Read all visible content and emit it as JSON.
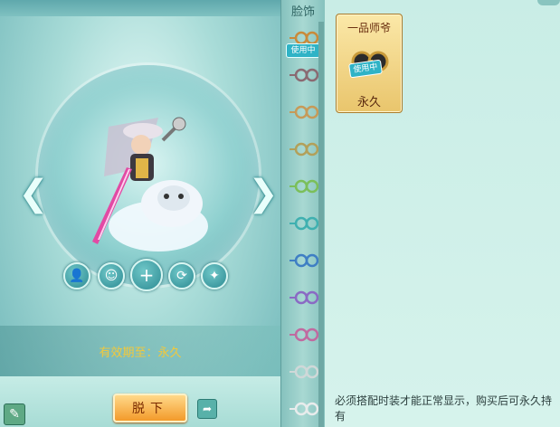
{
  "category": {
    "title": "脸饰",
    "in_use_tag": "使用中"
  },
  "swatches": [
    {
      "color": "#c98a3a"
    },
    {
      "color": "#8a6a72"
    },
    {
      "color": "#c69a58"
    },
    {
      "color": "#b2a05a"
    },
    {
      "color": "#7bbf5a"
    },
    {
      "color": "#3fb0b0"
    },
    {
      "color": "#3f7fc4"
    },
    {
      "color": "#8a6ac4"
    },
    {
      "color": "#c06aa0"
    },
    {
      "color": "#cfd8d8"
    },
    {
      "color": "#e8ecec"
    }
  ],
  "item": {
    "name": "一品师爷",
    "tag": "使用中",
    "duration": "永久"
  },
  "preview": {
    "validity": "有效期至：永久"
  },
  "buttons": {
    "remove": "脱下"
  },
  "note": "必须搭配时装才能正常显示，购买后可永久持有",
  "icons": [
    "arrow-left-icon",
    "arrow-right-icon",
    "person-icon",
    "face-icon",
    "plus-icon",
    "rotate-icon",
    "outfit-icon",
    "edit-icon",
    "share-icon"
  ]
}
